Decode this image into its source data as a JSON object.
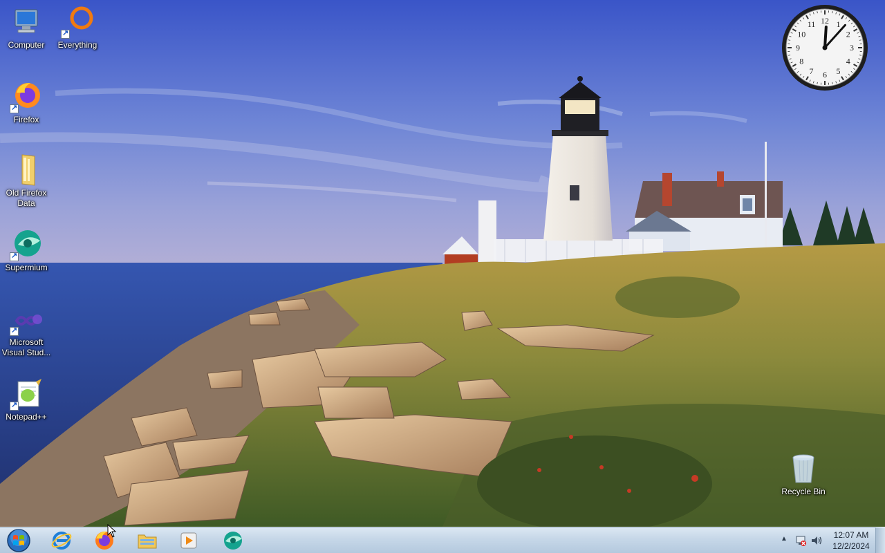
{
  "desktop": {
    "icons": [
      {
        "label": "Computer",
        "icon": "computer-icon",
        "shortcut": false
      },
      {
        "label": "Everything",
        "icon": "everything-search-icon",
        "shortcut": true
      },
      {
        "label": "Firefox",
        "icon": "firefox-icon",
        "shortcut": true
      },
      {
        "label": "Old Firefox Data",
        "icon": "folder-icon",
        "shortcut": false
      },
      {
        "label": "Supermium",
        "icon": "supermium-icon",
        "shortcut": true
      },
      {
        "label": "Microsoft Visual Stud...",
        "icon": "visual-studio-icon",
        "shortcut": true
      },
      {
        "label": "Notepad++",
        "icon": "notepad-plus-plus-icon",
        "shortcut": true
      },
      {
        "label": "Recycle Bin",
        "icon": "recycle-bin-icon",
        "shortcut": false
      }
    ]
  },
  "clock_gadget": {
    "numerals": [
      "12",
      "1",
      "2",
      "3",
      "4",
      "5",
      "6",
      "7",
      "8",
      "9",
      "10",
      "11"
    ],
    "time": "12:07"
  },
  "taskbar": {
    "start_icon": "windows-start-orb",
    "pinned": [
      {
        "name": "Internet Explorer",
        "icon": "internet-explorer-icon"
      },
      {
        "name": "Firefox",
        "icon": "firefox-icon"
      },
      {
        "name": "Windows Explorer",
        "icon": "file-explorer-icon"
      },
      {
        "name": "Windows Media Player",
        "icon": "media-player-icon"
      },
      {
        "name": "Supermium",
        "icon": "supermium-icon"
      }
    ],
    "tray": {
      "time": "12:07 AM",
      "date": "12/2/2024",
      "show_hidden_icon": "chevron-up-icon",
      "network_icon": "network-icon",
      "volume_icon": "speaker-icon"
    }
  },
  "colors": {
    "sky_top": "#3f58c9",
    "sea": "#2b4a9e",
    "taskbar": "#c6d7e8",
    "label_text": "#ffffff"
  }
}
